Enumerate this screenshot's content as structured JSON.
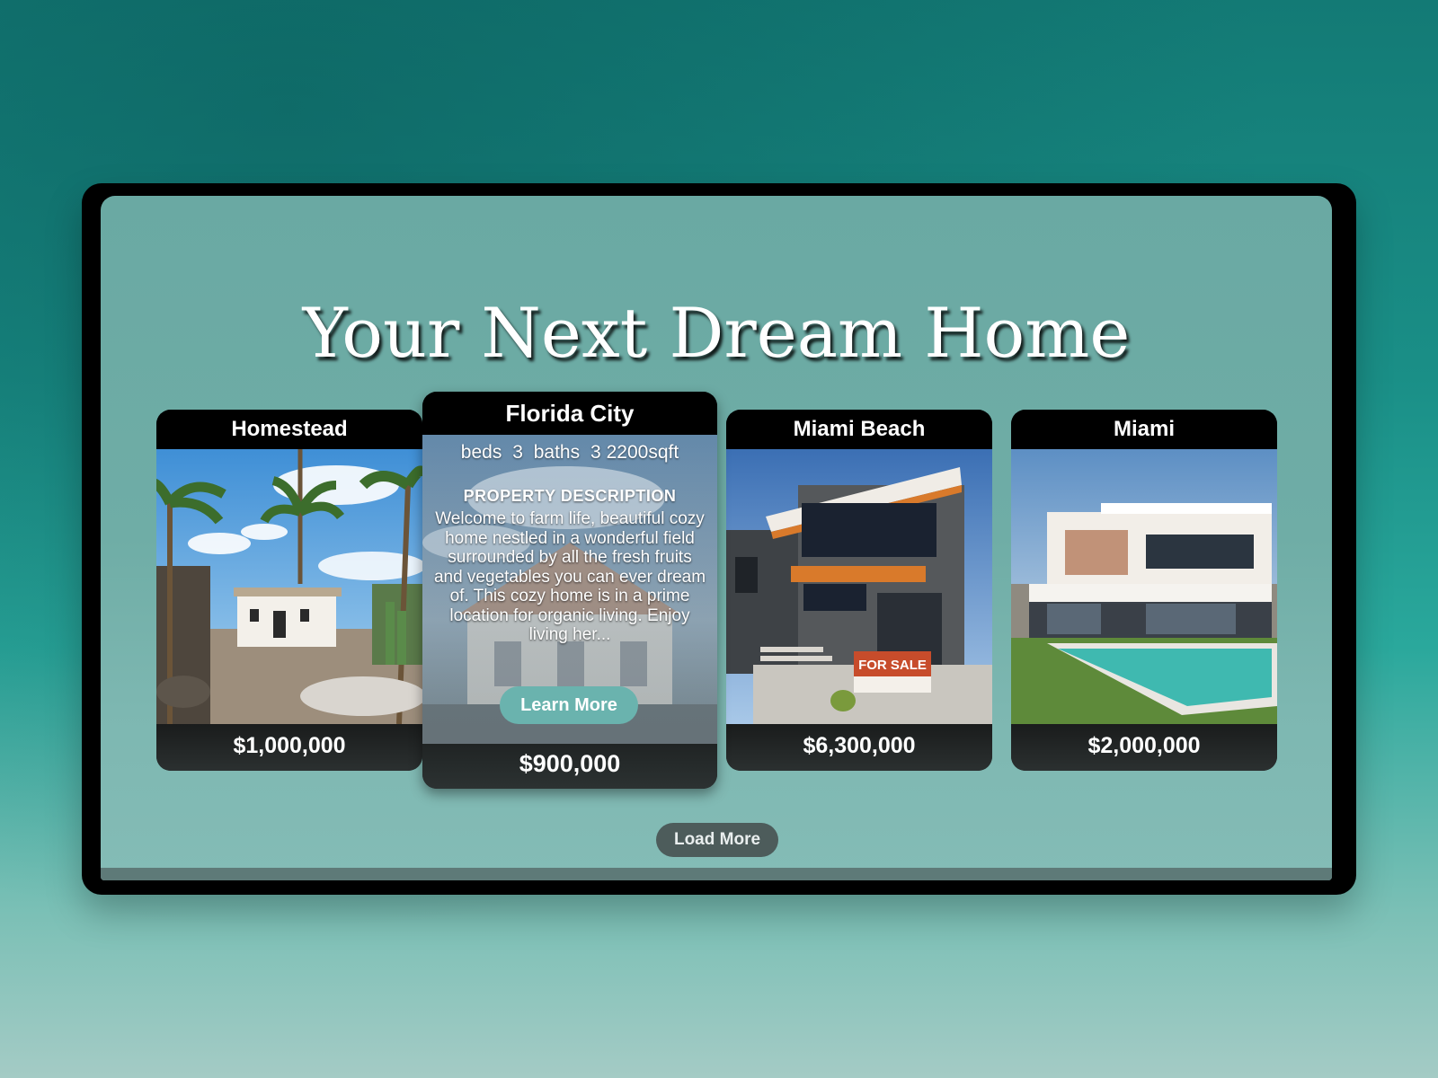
{
  "page": {
    "title": "Your Next Dream Home",
    "load_more_label": "Load More"
  },
  "listings": [
    {
      "city": "Homestead",
      "price": "$1,000,000",
      "image": "desert-cottage-photo"
    },
    {
      "city": "Florida City",
      "price": "$900,000",
      "image": "farmhouse-photo",
      "stats": {
        "beds_label": "beds",
        "beds_value": "3",
        "baths_label": "baths",
        "baths_value": "3",
        "area": "2200sqft"
      },
      "description_heading": "PROPERTY DESCRIPTION",
      "description": "Welcome to farm life, beautiful cozy home nestled in a wonderful field surrounded by all the fresh fruits and vegetables you can ever dream of. This cozy home is in a prime location for organic living. Enjoy living her...",
      "learn_more_label": "Learn More"
    },
    {
      "city": "Miami Beach",
      "price": "$6,300,000",
      "image": "modern-house-photo",
      "sign_text": "FOR SALE"
    },
    {
      "city": "Miami",
      "price": "$2,000,000",
      "image": "villa-pool-photo"
    }
  ]
}
